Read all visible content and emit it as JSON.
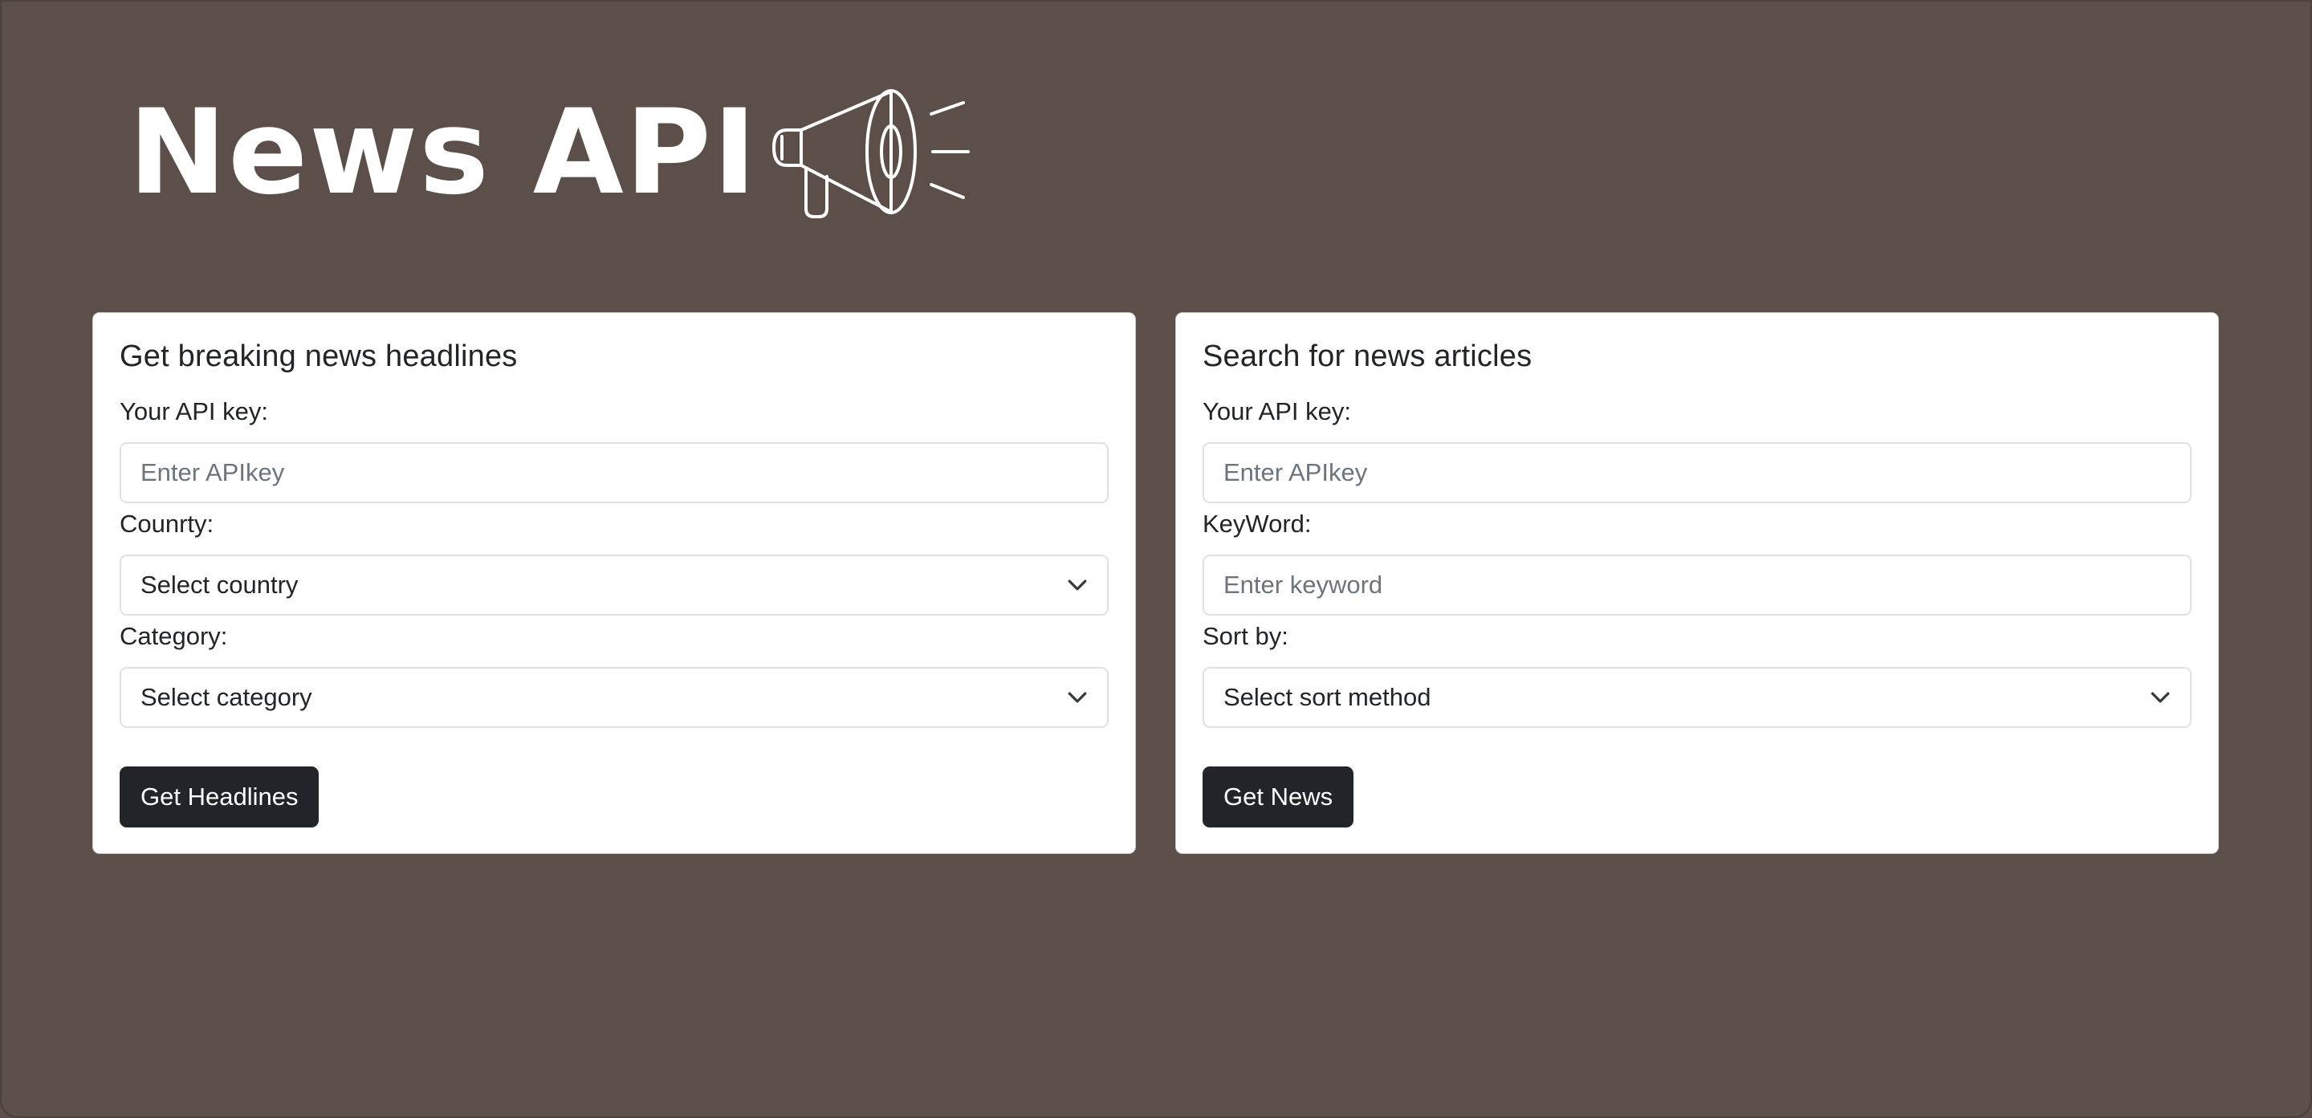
{
  "logo": {
    "text": "News API",
    "icon": "megaphone-icon"
  },
  "headlines_card": {
    "title": "Get breaking news headlines",
    "api_key_label": "Your API key:",
    "api_key_placeholder": "Enter APIkey",
    "country_label": "Counrty:",
    "country_selected": "Select country",
    "category_label": "Category:",
    "category_selected": "Select category",
    "button_label": "Get Headlines"
  },
  "search_card": {
    "title": "Search for news articles",
    "api_key_label": "Your API key:",
    "api_key_placeholder": "Enter APIkey",
    "keyword_label": "KeyWord:",
    "keyword_placeholder": "Enter keyword",
    "sort_label": "Sort by:",
    "sort_selected": "Select sort method",
    "button_label": "Get News"
  },
  "colors": {
    "background": "#5c4f4a",
    "card": "#ffffff",
    "button": "#212529",
    "text": "#212529",
    "placeholder": "#6c757d"
  }
}
